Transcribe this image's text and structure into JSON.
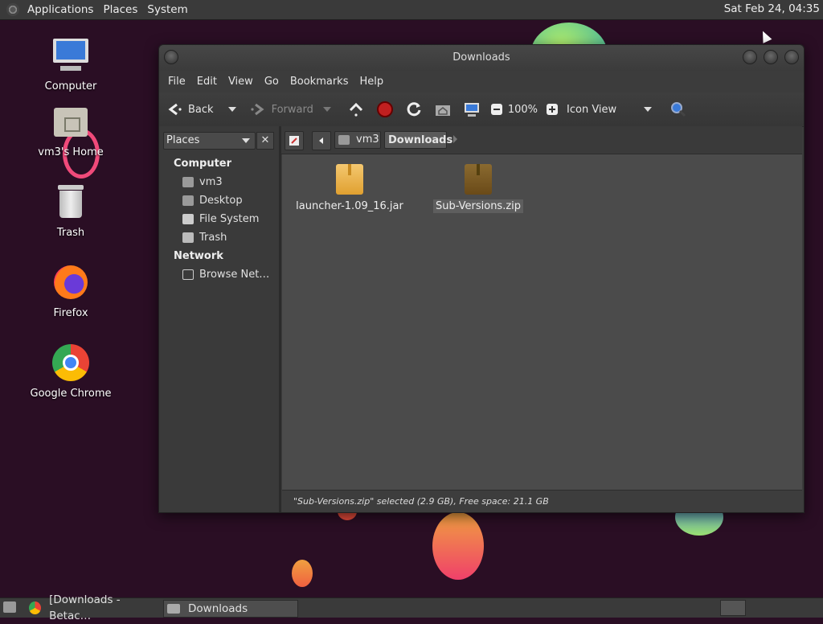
{
  "top_panel": {
    "menus": [
      "Applications",
      "Places",
      "System"
    ],
    "clock": "Sat Feb 24, 04:35"
  },
  "desktop": {
    "icons": [
      {
        "label": "Computer"
      },
      {
        "label": "vm3's Home"
      },
      {
        "label": "Trash"
      },
      {
        "label": "Firefox"
      },
      {
        "label": "Google Chrome"
      }
    ]
  },
  "window": {
    "title": "Downloads",
    "menu": [
      "File",
      "Edit",
      "View",
      "Go",
      "Bookmarks",
      "Help"
    ],
    "toolbar": {
      "back": "Back",
      "forward": "Forward",
      "zoom": "100%",
      "view_mode": "Icon View"
    },
    "sidebar": {
      "selector": "Places",
      "close": "✕",
      "sections": [
        {
          "heading": "Computer",
          "items": [
            "vm3",
            "Desktop",
            "File System",
            "Trash"
          ]
        },
        {
          "heading": "Network",
          "items": [
            "Browse Net…"
          ]
        }
      ]
    },
    "pathbar": {
      "crumbs": [
        "vm3",
        "Downloads"
      ]
    },
    "files": [
      {
        "name": "launcher-1.09_16.jar",
        "selected": false
      },
      {
        "name": "Sub-Versions.zip",
        "selected": true
      }
    ],
    "status": "\"Sub-Versions.zip\" selected (2.9 GB), Free space: 21.1 GB"
  },
  "taskbar": {
    "tasks": [
      "[Downloads - Betac…",
      "Downloads"
    ]
  }
}
